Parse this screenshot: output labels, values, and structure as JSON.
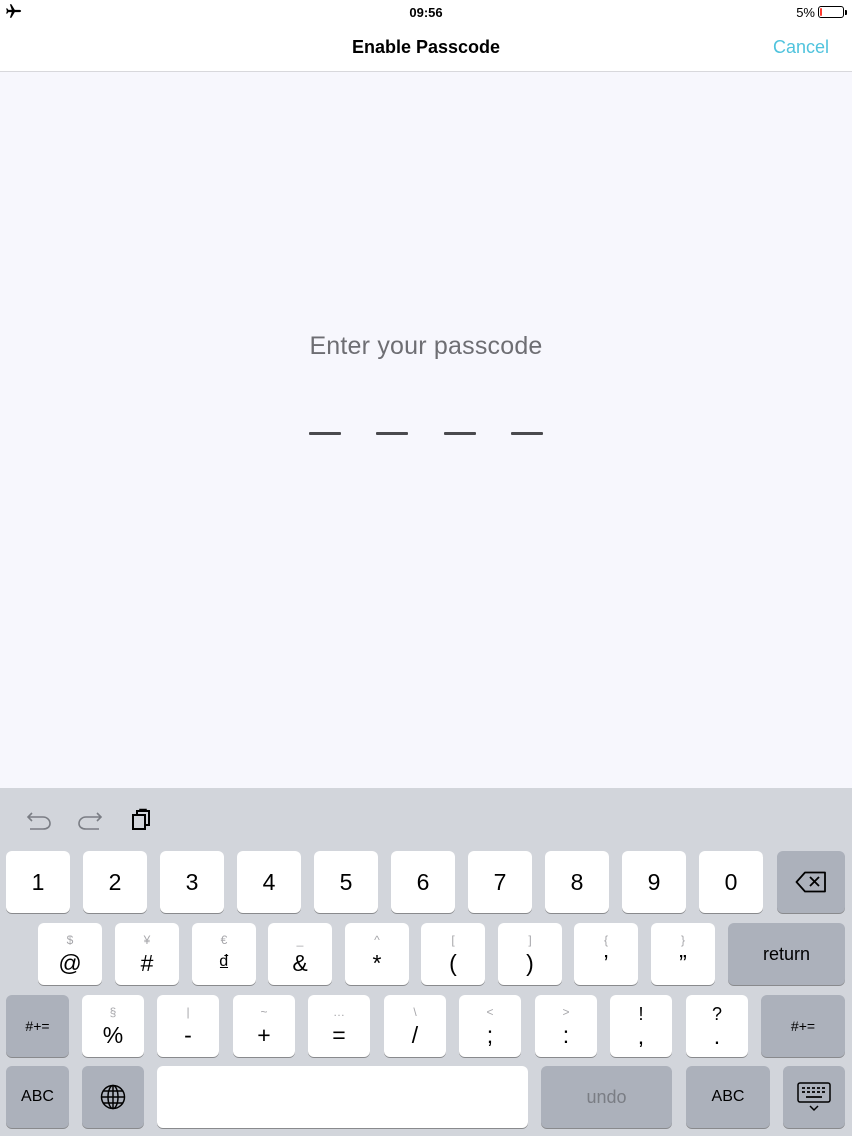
{
  "status_bar": {
    "time": "09:56",
    "battery_percent": "5%",
    "battery_level": 0.05
  },
  "nav": {
    "title": "Enable Passcode",
    "cancel_label": "Cancel"
  },
  "main": {
    "prompt": "Enter your passcode",
    "passcode_length": 4
  },
  "keyboard": {
    "toolbar": [
      "undo-icon",
      "redo-icon",
      "paste-icon"
    ],
    "row1": [
      "1",
      "2",
      "3",
      "4",
      "5",
      "6",
      "7",
      "8",
      "9",
      "0"
    ],
    "row2": [
      {
        "alt": "$",
        "main": "@"
      },
      {
        "alt": "¥",
        "main": "#"
      },
      {
        "alt": "€",
        "main": "₫"
      },
      {
        "alt": "_",
        "main": "&"
      },
      {
        "alt": "^",
        "main": "*"
      },
      {
        "alt": "[",
        "main": "("
      },
      {
        "alt": "]",
        "main": ")"
      },
      {
        "alt": "{",
        "main": "’"
      },
      {
        "alt": "}",
        "main": "”"
      }
    ],
    "return_label": "return",
    "row3": [
      {
        "alt": "§",
        "main": "%"
      },
      {
        "alt": "|",
        "main": "-"
      },
      {
        "alt": "~",
        "main": "+"
      },
      {
        "alt": "…",
        "main": "="
      },
      {
        "alt": "\\",
        "main": "/"
      },
      {
        "alt": "<",
        "main": ";"
      },
      {
        "alt": ">",
        "main": ":"
      },
      {
        "alt": "!",
        "main": ","
      },
      {
        "alt": "?",
        "main": "."
      }
    ],
    "shift_left_label": "#+=",
    "shift_right_label": "#+=",
    "abc_left_label": "ABC",
    "abc_right_label": "ABC",
    "undo_label": "undo"
  }
}
